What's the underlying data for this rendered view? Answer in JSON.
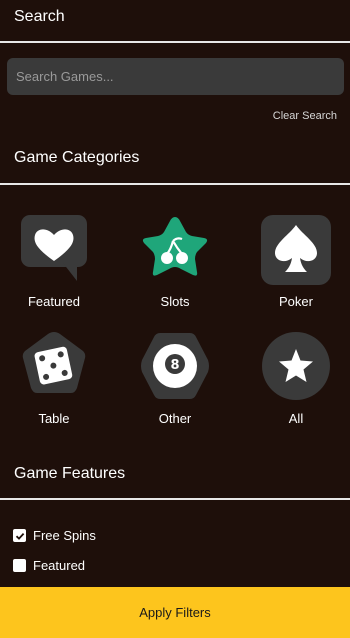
{
  "search": {
    "title": "Search",
    "placeholder": "Search Games...",
    "clear_label": "Clear Search"
  },
  "categories": {
    "title": "Game Categories",
    "items": [
      {
        "label": "Featured",
        "icon": "heart-speech-bubble-icon"
      },
      {
        "label": "Slots",
        "icon": "cherries-star-icon"
      },
      {
        "label": "Poker",
        "icon": "spade-icon"
      },
      {
        "label": "Table",
        "icon": "dice-icon"
      },
      {
        "label": "Other",
        "icon": "eight-ball-icon"
      },
      {
        "label": "All",
        "icon": "star-icon"
      }
    ],
    "icon_bg": "#3a3a3a",
    "active_icon_bg": "#1fa67a",
    "active_item": "Slots"
  },
  "features": {
    "title": "Game Features",
    "options": [
      {
        "label": "Free Spins",
        "checked": true
      },
      {
        "label": "Featured",
        "checked": false
      }
    ]
  },
  "apply_button": {
    "label": "Apply Filters",
    "color": "#fdc51d"
  },
  "colors": {
    "background": "#1e0f0a",
    "divider": "#e8e8e8"
  }
}
